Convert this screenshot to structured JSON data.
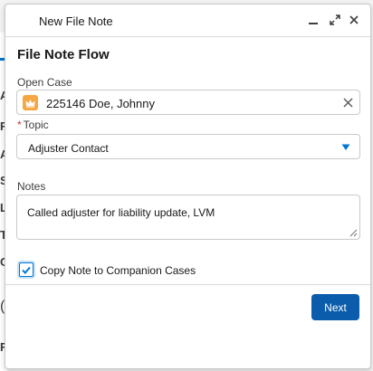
{
  "background": {
    "letters": [
      "A",
      "R",
      "A",
      "S",
      "L",
      "T",
      "C",
      "(",
      "F"
    ]
  },
  "modal": {
    "title": "New File Note",
    "controls": {
      "minimize_icon": "minimize-icon",
      "expand_icon": "expand-icon",
      "close_icon": "close-icon"
    }
  },
  "flow": {
    "title": "File Note Flow",
    "open_case": {
      "label": "Open Case",
      "value": "225146 Doe, Johnny",
      "icon": "crown-icon",
      "icon_color": "#f4a743"
    },
    "topic": {
      "required_marker": "*",
      "label": "Topic",
      "value": "Adjuster Contact"
    },
    "notes": {
      "label": "Notes",
      "value": "Called adjuster for liability update, LVM"
    },
    "copy_note": {
      "label": "Copy Note to Companion Cases",
      "checked": true
    }
  },
  "footer": {
    "next_label": "Next"
  },
  "colors": {
    "primary_button": "#0b5cab",
    "checkbox_accent": "#0176d3",
    "required": "#c23934"
  }
}
